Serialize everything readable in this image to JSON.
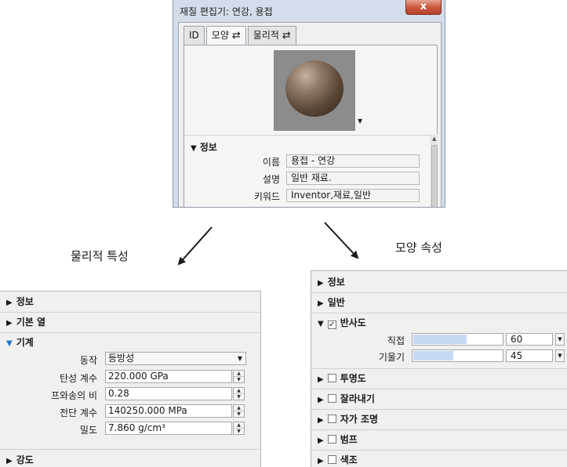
{
  "dialog": {
    "title": "재질 편집기: 연강, 용접",
    "close_label": "x",
    "tabs": [
      {
        "label": "ID"
      },
      {
        "label": "모양",
        "swap_icon": "⇄"
      },
      {
        "label": "물리적",
        "swap_icon": "⇄"
      }
    ],
    "info": {
      "header": "정보",
      "fields": [
        {
          "label": "이름",
          "value": "용접 - 연강"
        },
        {
          "label": "설명",
          "value": "일반 재료."
        },
        {
          "label": "키워드",
          "value": "Inventor,재료,일반"
        }
      ]
    }
  },
  "captions": {
    "physical": "물리적 특성",
    "appearance": "모양 속성"
  },
  "physical_panel": {
    "sections": {
      "info": "정보",
      "basic_heat": "기본 열",
      "mechanical": "기계",
      "strength": "강도"
    },
    "fields": {
      "behavior": {
        "label": "동작",
        "value": "등방성"
      },
      "youngs": {
        "label": "탄성 계수",
        "value": "220.000 GPa"
      },
      "poisson": {
        "label": "프와송의 비",
        "value": "0.28"
      },
      "shear": {
        "label": "전단 계수",
        "value": "140250.000 MPa"
      },
      "density": {
        "label": "밀도",
        "value": "7.860 g/cm³"
      }
    }
  },
  "appearance_panel": {
    "sections": {
      "info": "정보",
      "generic": "일반",
      "reflectivity": "반사도",
      "transparency": "투명도",
      "cutouts": "잘라내기",
      "self_illumination": "자가 조명",
      "bump": "범프",
      "tint": "색조"
    },
    "reflectivity_checked": true,
    "sliders": {
      "direct": {
        "label": "직접",
        "value": "60",
        "fraction": 0.6
      },
      "oblique": {
        "label": "기울기",
        "value": "45",
        "fraction": 0.45
      }
    }
  },
  "icons": {
    "expanded": "▼",
    "collapsed": "▶",
    "check": "✓"
  }
}
